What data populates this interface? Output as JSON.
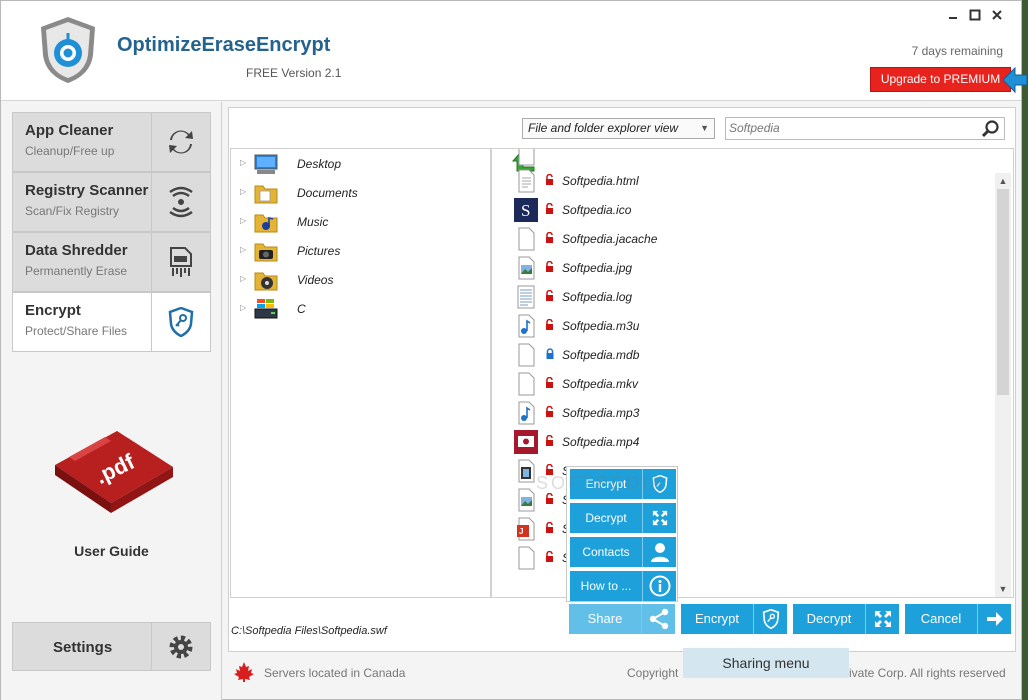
{
  "app": {
    "title": "OptimizeEraseEncrypt",
    "version": "FREE Version 2.1",
    "days_remaining": "7 days remaining",
    "upgrade_label": "Upgrade to PREMIUM",
    "accent": "#1ea0db",
    "brand": "#25638f",
    "upgrade_color": "#e8231e"
  },
  "window_controls": {
    "minimize": "minimize-icon",
    "maximize": "maximize-icon",
    "close": "close-icon"
  },
  "sidebar": {
    "items": [
      {
        "title": "App Cleaner",
        "sub": "Cleanup/Free up",
        "icon": "refresh-icon"
      },
      {
        "title": "Registry Scanner",
        "sub": "Scan/Fix Registry",
        "icon": "signal-icon"
      },
      {
        "title": "Data Shredder",
        "sub": "Permanently Erase",
        "icon": "shredder-icon"
      },
      {
        "title": "Encrypt",
        "sub": "Protect/Share Files",
        "icon": "shield-key-icon"
      }
    ],
    "guide_label": "User Guide",
    "guide_icon": "pdf-icon",
    "settings_label": "Settings",
    "settings_icon": "gear-icon"
  },
  "toolbar": {
    "view_select": "File and folder explorer view",
    "search_value": "Softpedia"
  },
  "tree": [
    {
      "label": "Desktop",
      "icon": "desktop-icon"
    },
    {
      "label": "Documents",
      "icon": "documents-folder-icon"
    },
    {
      "label": "Music",
      "icon": "music-folder-icon"
    },
    {
      "label": "Pictures",
      "icon": "pictures-folder-icon"
    },
    {
      "label": "Videos",
      "icon": "videos-folder-icon"
    },
    {
      "label": "C",
      "icon": "drive-icon"
    }
  ],
  "files": [
    {
      "name": "Softpedia.html",
      "icon": "file-text-icon",
      "lock": "unlocked"
    },
    {
      "name": "Softpedia.ico",
      "icon": "softpedia-ico-icon",
      "lock": "unlocked"
    },
    {
      "name": "Softpedia.jacache",
      "icon": "file-blank-icon",
      "lock": "unlocked"
    },
    {
      "name": "Softpedia.jpg",
      "icon": "image-file-icon",
      "lock": "unlocked"
    },
    {
      "name": "Softpedia.log",
      "icon": "log-file-icon",
      "lock": "unlocked"
    },
    {
      "name": "Softpedia.m3u",
      "icon": "audio-file-icon",
      "lock": "unlocked"
    },
    {
      "name": "Softpedia.mdb",
      "icon": "file-blank-icon",
      "lock": "locked"
    },
    {
      "name": "Softpedia.mkv",
      "icon": "file-blank-icon",
      "lock": "unlocked"
    },
    {
      "name": "Softpedia.mp3",
      "icon": "audio-file-icon",
      "lock": "unlocked"
    },
    {
      "name": "Softpedia.mp4",
      "icon": "video-file-icon",
      "lock": "unlocked"
    },
    {
      "name": "S",
      "icon": "film-file-icon",
      "lock": "unlocked"
    },
    {
      "name": "S",
      "icon": "image-file-icon",
      "lock": "unlocked"
    },
    {
      "name": "S",
      "icon": "pdf-file-icon",
      "lock": "unlocked"
    },
    {
      "name": "S",
      "icon": "file-blank-icon",
      "lock": "unlocked"
    }
  ],
  "path": "C:\\Softpedia Files\\Softpedia.swf",
  "actions": [
    {
      "label": "Share",
      "icon": "share-icon"
    },
    {
      "label": "Encrypt",
      "icon": "shield-key-icon"
    },
    {
      "label": "Decrypt",
      "icon": "expand-icon"
    },
    {
      "label": "Cancel",
      "icon": "arrow-right-icon"
    }
  ],
  "share_menu": [
    {
      "label": "Encrypt",
      "icon": "shield-key-icon"
    },
    {
      "label": "Decrypt",
      "icon": "expand-icon"
    },
    {
      "label": "Contacts",
      "icon": "user-icon"
    },
    {
      "label": "How to ...",
      "icon": "info-icon"
    }
  ],
  "tooltip": "Sharing menu",
  "watermark": "SOFTPEDIA",
  "footer": {
    "servers": "Servers located in Canada",
    "copyright_a": "Copyright",
    "copyright_b": "ivate Corp. All rights reserved"
  }
}
